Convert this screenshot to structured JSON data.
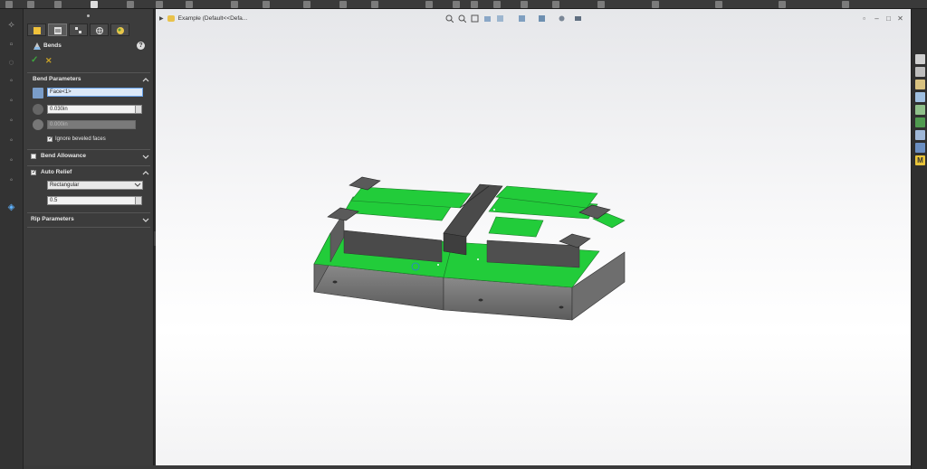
{
  "document": {
    "breadcrumb": "Example  (Default<<Defa..."
  },
  "feature": {
    "title": "Bends",
    "help_icon": "help-icon",
    "ok_icon": "check-icon",
    "cancel_icon": "cancel-x-icon"
  },
  "bend_parameters": {
    "header": "Bend Parameters",
    "fixed_face_value": "Face<1>",
    "bend_radius_value": "0.030in",
    "thickness_value": "0.000in",
    "ignore_beveled_label": "Ignore beveled faces",
    "ignore_beveled_checked": true
  },
  "bend_allowance": {
    "header": "Bend Allowance",
    "checked": false
  },
  "auto_relief": {
    "header": "Auto Relief",
    "checked": true,
    "type_value": "Rectangular",
    "ratio_value": "0.5"
  },
  "rip_parameters": {
    "header": "Rip Parameters"
  },
  "pm_tabs": [
    "feature-manager-icon",
    "property-manager-icon",
    "configuration-manager-icon",
    "dimxpert-icon",
    "display-manager-icon"
  ],
  "right_rail": [
    "home-icon",
    "resources-icon",
    "design-library-icon",
    "file-explorer-icon",
    "view-palette-icon",
    "appearances-icon",
    "custom-properties-icon",
    "3dexperience-icon",
    "m-icon"
  ],
  "model_color": "#22cc3a"
}
